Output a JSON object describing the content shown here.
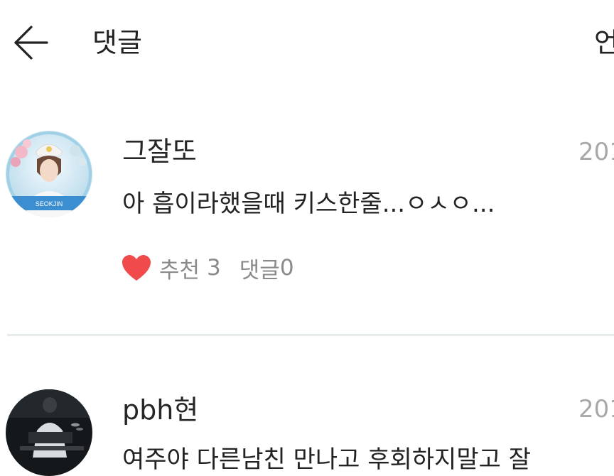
{
  "header": {
    "title": "댓글",
    "right_text": "언"
  },
  "comments": [
    {
      "username": "그잘또",
      "date": "201",
      "text": "아 흡이라했을때 키스한줄...ㅇㅅㅇ...",
      "avatar_label": "SEOKJIN",
      "like_label": "추천",
      "like_count": "3",
      "reply_label": "댓글",
      "reply_count": "0"
    },
    {
      "username": "pbh현",
      "date": "201",
      "text": "여주야 다른남친 만나고 후회하지말고 잘"
    }
  ],
  "colors": {
    "heart": "#f04a4a",
    "divider": "#e6ebec",
    "date": "#a8a8a8",
    "meta": "#8a8a8a"
  }
}
